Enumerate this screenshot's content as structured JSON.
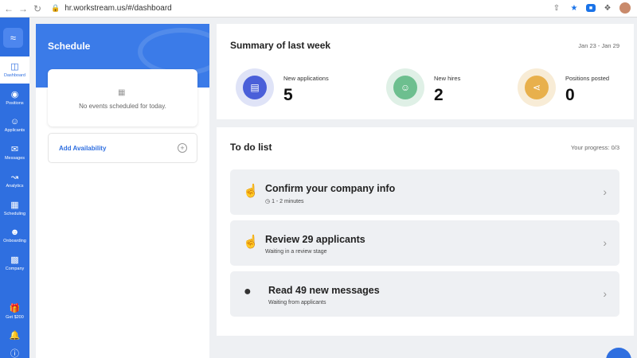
{
  "browser": {
    "url": "hr.workstream.us/#/dashboard"
  },
  "nav": {
    "items": [
      {
        "label": "Dashboard",
        "icon": "dashboard-icon"
      },
      {
        "label": "Positions",
        "icon": "positions-icon"
      },
      {
        "label": "Applicants",
        "icon": "applicants-icon"
      },
      {
        "label": "Messages",
        "icon": "messages-icon"
      },
      {
        "label": "Analytics",
        "icon": "analytics-icon"
      },
      {
        "label": "Scheduling",
        "icon": "scheduling-icon"
      },
      {
        "label": "Onboarding",
        "icon": "onboarding-icon"
      },
      {
        "label": "Company",
        "icon": "company-icon"
      },
      {
        "label": "Get $200",
        "icon": "gift-icon"
      }
    ],
    "active": "Dashboard"
  },
  "schedule": {
    "title": "Schedule",
    "empty_text": "No events scheduled for today.",
    "add_availability": "Add Availability"
  },
  "summary": {
    "title": "Summary of last week",
    "date_range": "Jan 23 - Jan 29",
    "stats": [
      {
        "label": "New applications",
        "value": "5",
        "color": "#4a5fd9",
        "ring": "#dfe3f7",
        "icon": "document-icon"
      },
      {
        "label": "New hires",
        "value": "2",
        "color": "#6dbf8f",
        "ring": "#dff0e6",
        "icon": "user-check-icon"
      },
      {
        "label": "Positions posted",
        "value": "0",
        "color": "#e8b04c",
        "ring": "#f8ecd6",
        "icon": "share-icon"
      }
    ]
  },
  "todo": {
    "title": "To do list",
    "progress": "Your progress: 0/3",
    "tasks": [
      {
        "title": "Confirm your company info",
        "subtitle": "1 - 2 minutes",
        "icon": "hand-pointer-icon"
      },
      {
        "title": "Review 29 applicants",
        "subtitle": "Waiting in a review stage",
        "icon": "hand-pointer-icon"
      },
      {
        "title": "Read 49 new messages",
        "subtitle": "Waiting from applicants",
        "icon": "chat-bubble-icon"
      }
    ]
  },
  "colors": {
    "accent": "#2f6fe0",
    "sidebar": "#2f6fe0",
    "background": "#eef0f3"
  }
}
